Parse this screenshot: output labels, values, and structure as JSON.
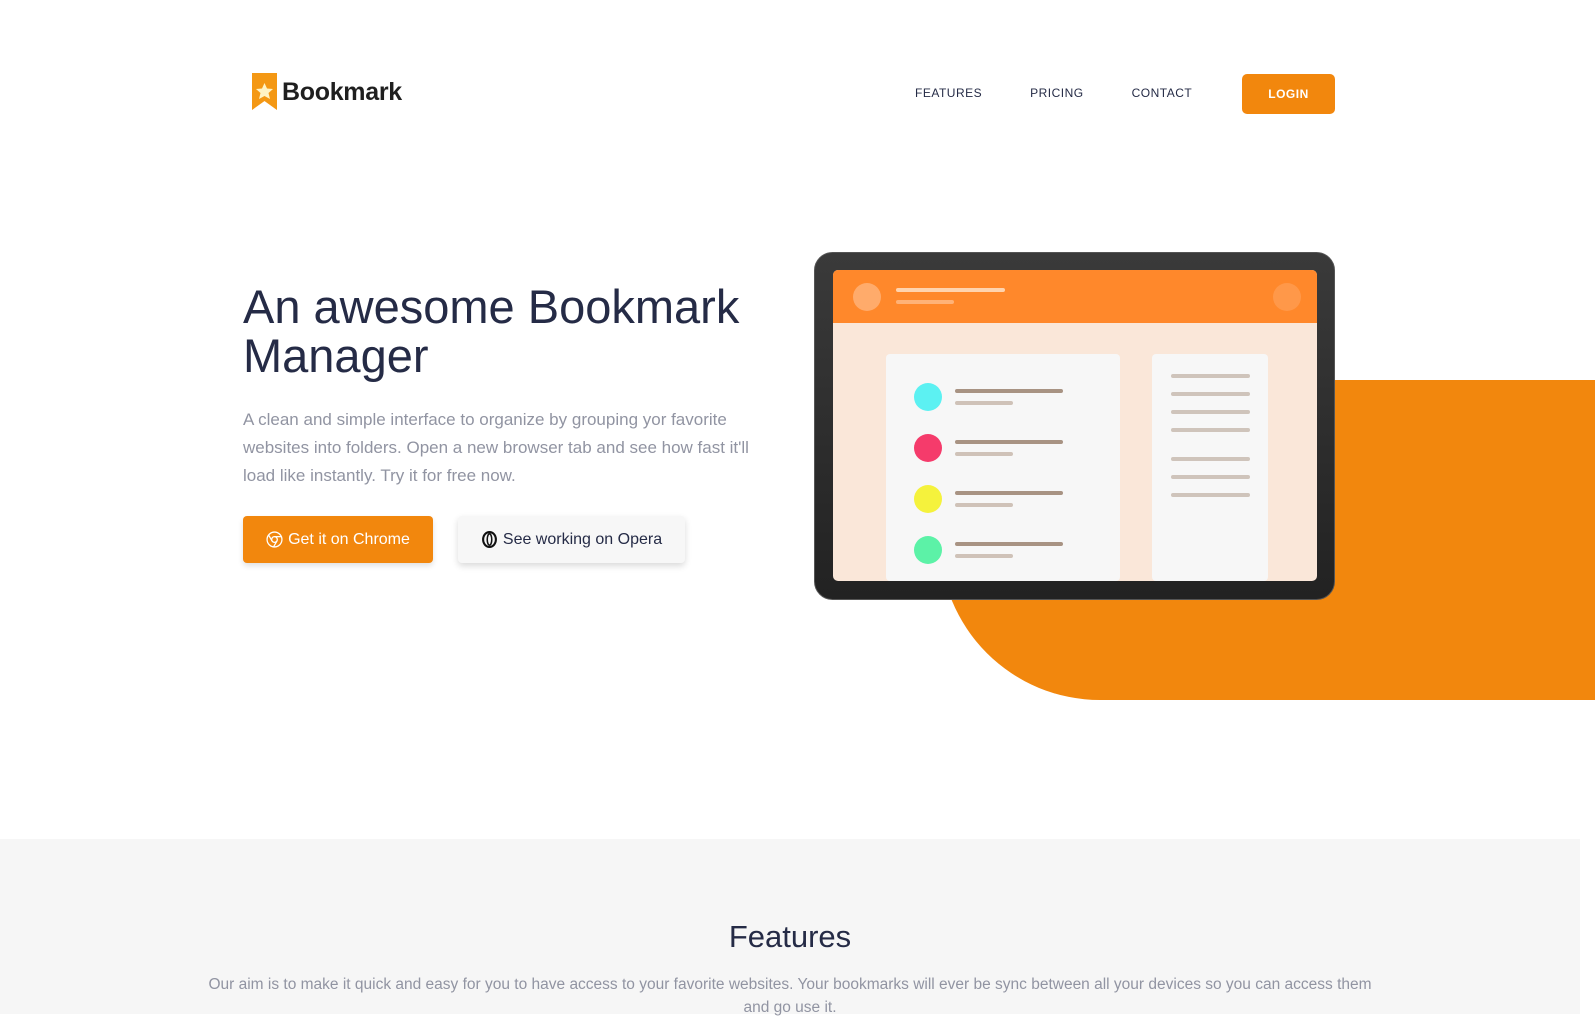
{
  "brand": {
    "name": "Bookmark",
    "logo_icon": "bookmark-star-icon",
    "accent_color": "#f2870d"
  },
  "nav": {
    "links": [
      "FEATURES",
      "PRICING",
      "CONTACT"
    ],
    "login_label": "LOGIN"
  },
  "hero": {
    "title": "An awesome Bookmark Manager",
    "description": "A clean and simple interface to organize by grouping yor favorite websites into folders. Open a new browser tab and see how fast it'll load like instantly. Try it for free now.",
    "chrome_button": {
      "label": "Get it on Chrome",
      "icon": "chrome-icon"
    },
    "opera_button": {
      "label": "See working on Opera",
      "icon": "opera-icon"
    },
    "illustration": {
      "icon": "tablet-illustration",
      "dot_colors": [
        "#5cf1f2",
        "#f53b6b",
        "#f5f23c",
        "#5cf2a7"
      ]
    }
  },
  "features": {
    "title": "Features",
    "description": "Our aim is to make it quick and easy for you to have access to your favorite websites. Your bookmarks will ever be sync between all your devices so you can access them and go use it."
  }
}
